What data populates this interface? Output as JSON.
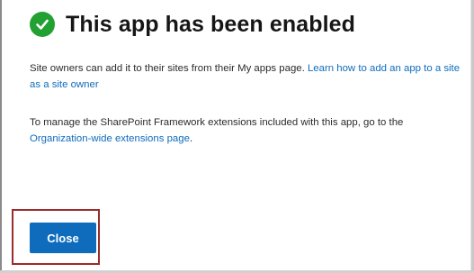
{
  "dialog": {
    "title": "This app has been enabled",
    "status_icon": "check-circle-icon",
    "paragraph1": {
      "text": "Site owners can add it to their sites from their My apps page. ",
      "link": "Learn how to add an app to a site as a site owner"
    },
    "paragraph2": {
      "text": "To manage the SharePoint Framework extensions included with this app, go to the ",
      "link": "Organization-wide extensions page",
      "suffix": "."
    },
    "close_label": "Close"
  },
  "colors": {
    "success": "#22a032",
    "accent": "#0f6cbd",
    "highlight": "#9b2c2c"
  }
}
